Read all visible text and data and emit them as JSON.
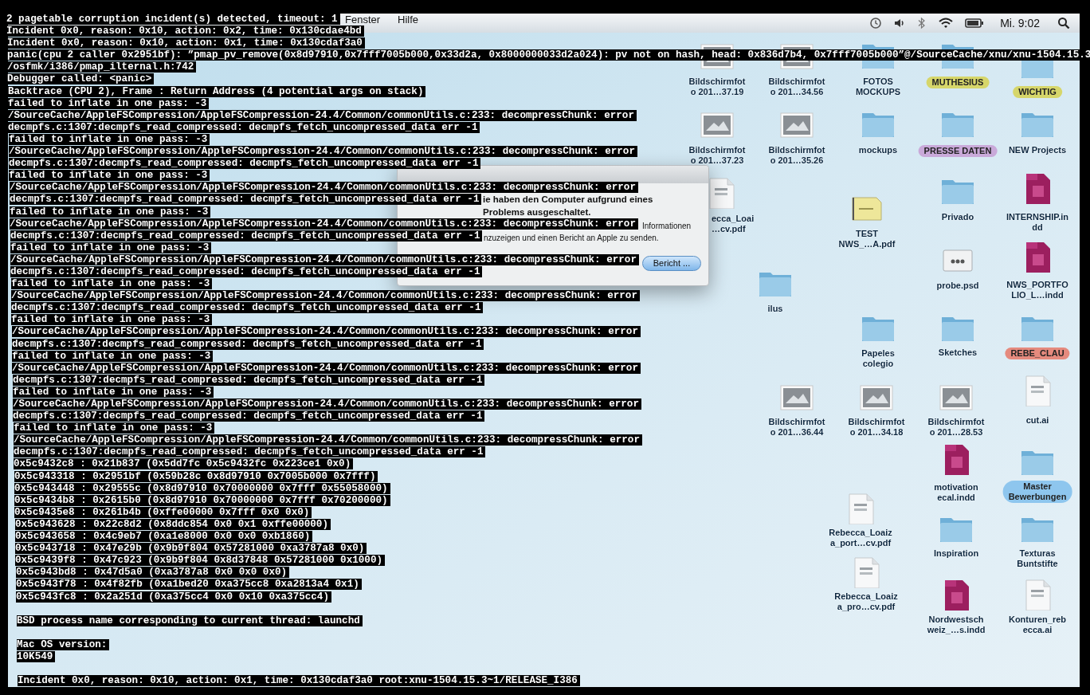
{
  "console": {
    "lines": [
      {
        "text": "2 pagetable corruption incident(s) detected, timeout: 1"
      },
      {
        "text": "Incident 0x0, reason: 0x10, action: 0x2, time: 0x130cdae4bd"
      },
      {
        "text": "Incident 0x0, reason: 0x10, action: 0x1, time: 0x130cdaf3a0"
      },
      {
        "text": "panic(cpu 2 caller 0x2951bf): ”pmap_pv_remove(0x8d97910,0x7fff7005b000,0x33d2a, 0x8000000033d2a024): pv not on hash, head: 0x836d7b4, 0x7fff7005b000”@/SourceCache/xnu/xnu-1504.15.3"
      },
      {
        "text": "/osfmk/i386/pmap_ilternal.h:742"
      },
      {
        "text": "Debugger called: <panic>"
      },
      {
        "text": "Backtrace (CPU 2), Frame : Return Address (4 potential args on stack)"
      },
      {
        "text": "failed to inflate in one pass: -3"
      },
      {
        "text": "/SourceCache/AppleFSCompression/AppleFSCompression-24.4/Common/commonUtils.c:233: decompressChunk: error"
      },
      {
        "text": "decmpfs.c:1307:decmpfs_read_compressed: decmpfs_fetch_uncompressed_data err -1"
      },
      {
        "text": "failed to inflate in one pass: -3"
      },
      {
        "text": "/SourceCache/AppleFSCompression/AppleFSCompression-24.4/Common/commonUtils.c:233: decompressChunk: error"
      },
      {
        "text": "decmpfs.c:1307:decmpfs_read_compressed: decmpfs_fetch_uncompressed_data err -1"
      },
      {
        "text": "failed to inflate in one pass: -3"
      },
      {
        "text": "/SourceCache/AppleFSCompression/AppleFSCompression-24.4/Common/commonUtils.c:233: decompressChunk: error"
      },
      {
        "text": "decmpfs.c:1307:decmpfs_read_compressed: decmpfs_fetch_uncompressed_data err -1"
      },
      {
        "text": "failed to inflate in one pass: -3"
      },
      {
        "text": "/SourceCache/AppleFSCompression/AppleFSCompression-24.4/Common/commonUtils.c:233: decompressChunk: error"
      },
      {
        "text": "decmpfs.c:1307:decmpfs_read_compressed: decmpfs_fetch_uncompressed_data err -1"
      },
      {
        "text": "failed to inflate in one pass: -3"
      },
      {
        "text": "/SourceCache/AppleFSCompression/AppleFSCompression-24.4/Common/commonUtils.c:233: decompressChunk: error"
      },
      {
        "text": "decmpfs.c:1307:decmpfs_read_compressed: decmpfs_fetch_uncompressed_data err -1"
      },
      {
        "text": "failed to inflate in one pass: -3"
      },
      {
        "text": "/SourceCache/AppleFSCompression/AppleFSCompression-24.4/Common/commonUtils.c:233: decompressChunk: error"
      },
      {
        "text": "decmpfs.c:1307:decmpfs_read_compressed: decmpfs_fetch_uncompressed_data err -1"
      },
      {
        "text": "failed to inflate in one pass: -3"
      },
      {
        "text": "/SourceCache/AppleFSCompression/AppleFSCompression-24.4/Common/commonUtils.c:233: decompressChunk: error"
      },
      {
        "text": "decmpfs.c:1307:decmpfs_read_compressed: decmpfs_fetch_uncompressed_data err -1"
      },
      {
        "text": "failed to inflate in one pass: -3"
      },
      {
        "text": "/SourceCache/AppleFSCompression/AppleFSCompression-24.4/Common/commonUtils.c:233: decompressChunk: error"
      },
      {
        "text": "decmpfs.c:1307:decmpfs_read_compressed: decmpfs_fetch_uncompressed_data err -1"
      },
      {
        "text": "failed to inflate in one pass: -3"
      },
      {
        "text": "/SourceCache/AppleFSCompression/AppleFSCompression-24.4/Common/commonUtils.c:233: decompressChunk: error"
      },
      {
        "text": "decmpfs.c:1307:decmpfs_read_compressed: decmpfs_fetch_uncompressed_data err -1"
      },
      {
        "text": "failed to inflate in one pass: -3"
      },
      {
        "text": "/SourceCache/AppleFSCompression/AppleFSCompression-24.4/Common/commonUtils.c:233: decompressChunk: error"
      },
      {
        "text": "decmpfs.c:1307:decmpfs_read_compressed: decmpfs_fetch_uncompressed_data err -1"
      },
      {
        "text": "0x5c9432c8 : 0x21b837 (0x5dd7fc 0x5c9432fc 0x223ce1 0x0)"
      },
      {
        "text": "0x5c943318 : 0x2951bf (0x59b28c 0x8d97910 0x7005b000 0x7fff)"
      },
      {
        "text": "0x5c943448 : 0x29555c (0x8d97910 0x70000000 0x7fff 0x55058000)"
      },
      {
        "text": "0x5c9434b8 : 0x2615b0 (0x8d97910 0x70000000 0x7fff 0x70200000)"
      },
      {
        "text": "0x5c9435e8 : 0x261b4b (0xffe00000 0x7fff 0x0 0x0)"
      },
      {
        "text": "0x5c943628 : 0x22c8d2 (0x8ddc854 0x0 0x1 0xffe00000)"
      },
      {
        "text": "0x5c943658 : 0x4c9eb7 (0xa1e8000 0x0 0x0 0xb1860)"
      },
      {
        "text": "0x5c943718 : 0x47e29b (0x9b9f804 0x57281000 0xa3787a8 0x0)"
      },
      {
        "text": "0x5c9439f8 : 0x47c923 (0x9b9f804 0x8d37848 0x57281000 0x1000)"
      },
      {
        "text": "0x5c943bd8 : 0x47d5a0 (0xa3787a8 0x0 0x0 0x0)"
      },
      {
        "text": "0x5c943f78 : 0x4f82fb (0xa1bed20 0xa375cc8 0xa2813a4 0x1)"
      },
      {
        "text": "0x5c943fc8 : 0x2a251d (0xa375cc4 0x0 0x10 0xa375cc4)"
      },
      {
        "kind": "blank"
      },
      {
        "text": "BSD process name corresponding to current thread: launchd"
      },
      {
        "kind": "blank"
      },
      {
        "text": "Mac OS version:"
      },
      {
        "text": "10K549"
      },
      {
        "kind": "blank"
      },
      {
        "text": "Incident 0x0, reason: 0x10, action: 0x1, time: 0x130cdaf3a0 root:xnu-1504.15.3~1/RELEASE_I386"
      }
    ]
  },
  "menu_bar": {
    "menus": [
      "Fenster",
      "Hilfe"
    ],
    "clock": "Mi. 9:02"
  },
  "alert": {
    "lines": [
      {
        "kind": "heading",
        "text": "ie haben den Computer aufgrund eines"
      },
      {
        "kind": "heading",
        "text": "Problems ausgeschaltet."
      },
      {
        "kind": "body",
        "text": "Informationen"
      },
      {
        "kind": "body",
        "text": "nzuzeigen und einen Bericht an Apple zu senden."
      }
    ],
    "button": "Bericht ..."
  },
  "desktop_icons": [
    {
      "kind": "screenshot",
      "label": [
        "Bildschirmfot",
        "o 201…37.19"
      ]
    },
    {
      "kind": "screenshot",
      "label": [
        "Bildschirmfot",
        "o 201…34.56"
      ]
    },
    {
      "kind": "folder",
      "label": [
        "FOTOS",
        "MOCKUPS"
      ]
    },
    {
      "kind": "folder",
      "label": [
        "MUTHESIUS"
      ],
      "color": "#d6d66a"
    },
    {
      "kind": "folder",
      "label": [
        "WICHTIG"
      ],
      "color": "#d6d66a"
    },
    {
      "kind": "screenshot",
      "label": [
        "Bildschirmfot",
        "o 201…37.23"
      ]
    },
    {
      "kind": "screenshot",
      "label": [
        "Bildschirmfot",
        "o 201…35.26"
      ]
    },
    {
      "kind": "folder",
      "label": [
        "mockups"
      ]
    },
    {
      "kind": "folder",
      "label": [
        "PRESSE DATEN"
      ],
      "color": "#c9a9d9"
    },
    {
      "kind": "folder",
      "label": [
        "NEW Projects"
      ]
    },
    {
      "kind": "document",
      "label": [
        "ecca_Loai",
        "…cv.pdf"
      ]
    },
    {
      "kind": "note",
      "label": [
        "TEST",
        "NWS_…A.pdf"
      ]
    },
    {
      "kind": "folder",
      "label": [
        "Privado"
      ]
    },
    {
      "kind": "indesign",
      "label": [
        "INTERNSHIP.in",
        "dd"
      ]
    },
    {
      "kind": "folder",
      "label": [
        "ilus"
      ]
    },
    {
      "kind": "photoshop",
      "label": [
        "probe.psd"
      ]
    },
    {
      "kind": "indesign",
      "label": [
        "NWS_PORTFO",
        "LIO_L…indd"
      ]
    },
    {
      "kind": "folder",
      "label": [
        "Papeles",
        "colegio"
      ]
    },
    {
      "kind": "folder",
      "label": [
        "Sketches"
      ]
    },
    {
      "kind": "folder",
      "label": [
        "REBE_CLAU"
      ],
      "color": "#e58a7e"
    },
    {
      "kind": "screenshot",
      "label": [
        "Bildschirmfot",
        "o 201…36.44"
      ]
    },
    {
      "kind": "screenshot",
      "label": [
        "Bildschirmfot",
        "o 201…34.18"
      ]
    },
    {
      "kind": "screenshot",
      "label": [
        "Bildschirmfot",
        "o 201…28.53"
      ]
    },
    {
      "kind": "document",
      "label": [
        "cut.ai"
      ]
    },
    {
      "kind": "indesign",
      "label": [
        "motivation",
        "ecal.indd"
      ]
    },
    {
      "kind": "folder",
      "label": [
        "Master",
        "Bewerbungen"
      ],
      "color": "#8ec6ee"
    },
    {
      "kind": "document",
      "label": [
        "Rebecca_Loaiz",
        "a_port…cv.pdf"
      ]
    },
    {
      "kind": "folder",
      "label": [
        "Inspiration"
      ]
    },
    {
      "kind": "folder",
      "label": [
        "Texturas",
        "Buntstifte"
      ]
    },
    {
      "kind": "document",
      "label": [
        "Rebecca_Loaiz",
        "a_pro…cv.pdf"
      ]
    },
    {
      "kind": "indesign",
      "label": [
        "Nordwestsch",
        "weiz_…s.indd"
      ]
    },
    {
      "kind": "document",
      "label": [
        "Konturen_reb",
        "ecca.ai"
      ]
    }
  ]
}
